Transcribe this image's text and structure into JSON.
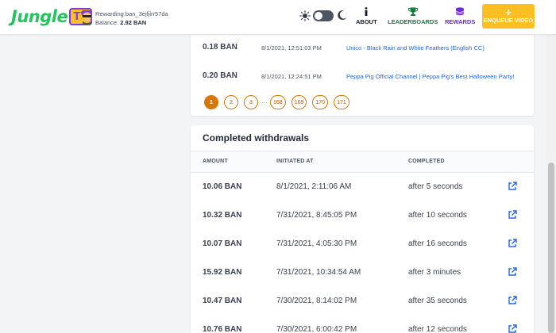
{
  "header": {
    "logo_text": "Jungle",
    "logo_badge": "TV",
    "rewarding_text": "Rewarding ban_3ejfjirr57da",
    "balance_label": "Balance:",
    "balance_value": "2.92 BAN",
    "nav": {
      "about": "ABOUT",
      "leaderboards": "LEADERBOARDS",
      "rewards": "REWARDS",
      "enqueue": "ENQUEUE VIDEO"
    }
  },
  "requests": {
    "rows": [
      {
        "amount": "0.18 BAN",
        "date": "8/1/2021, 12:51:03 PM",
        "video": "Unico - Black Rain and White Feathers (English CC)"
      },
      {
        "amount": "0.20 BAN",
        "date": "8/1/2021, 12:24:51 PM",
        "video": "Peppa Pig Official Channel | Peppa Pig's Best Halloween Party!"
      }
    ],
    "pages": [
      "1",
      "2",
      "3",
      "168",
      "169",
      "170",
      "171"
    ],
    "dots": "···"
  },
  "withdrawals": {
    "title": "Completed withdrawals",
    "headers": {
      "amount": "AMOUNT",
      "initiated": "INITIATED AT",
      "completed": "COMPLETED"
    },
    "rows": [
      {
        "amount": "10.06 BAN",
        "initiated": "8/1/2021, 2:11:06 AM",
        "completed": "after 5 seconds"
      },
      {
        "amount": "10.32 BAN",
        "initiated": "7/31/2021, 8:45:05 PM",
        "completed": "after 10 seconds"
      },
      {
        "amount": "10.07 BAN",
        "initiated": "7/31/2021, 4:05:30 PM",
        "completed": "after 16 seconds"
      },
      {
        "amount": "15.92 BAN",
        "initiated": "7/31/2021, 10:34:54 AM",
        "completed": "after 3 minutes"
      },
      {
        "amount": "10.47 BAN",
        "initiated": "7/30/2021, 8:14:02 PM",
        "completed": "after 35 seconds"
      },
      {
        "amount": "10.76 BAN",
        "initiated": "7/30/2021, 6:00:42 PM",
        "completed": "after 12 seconds"
      }
    ]
  },
  "colors": {
    "accent": "#d97706",
    "link": "#2563eb",
    "brand_green": "#22c55e",
    "rewards_purple": "#6d28d9",
    "enqueue_bg": "#fbbf24"
  },
  "icons": {
    "theme_light": "sun-icon",
    "theme_dark": "moon-icon",
    "about": "info-icon",
    "leaderboards": "trophy-icon",
    "rewards": "coins-icon",
    "enqueue": "plus-icon",
    "external": "external-link-icon"
  }
}
